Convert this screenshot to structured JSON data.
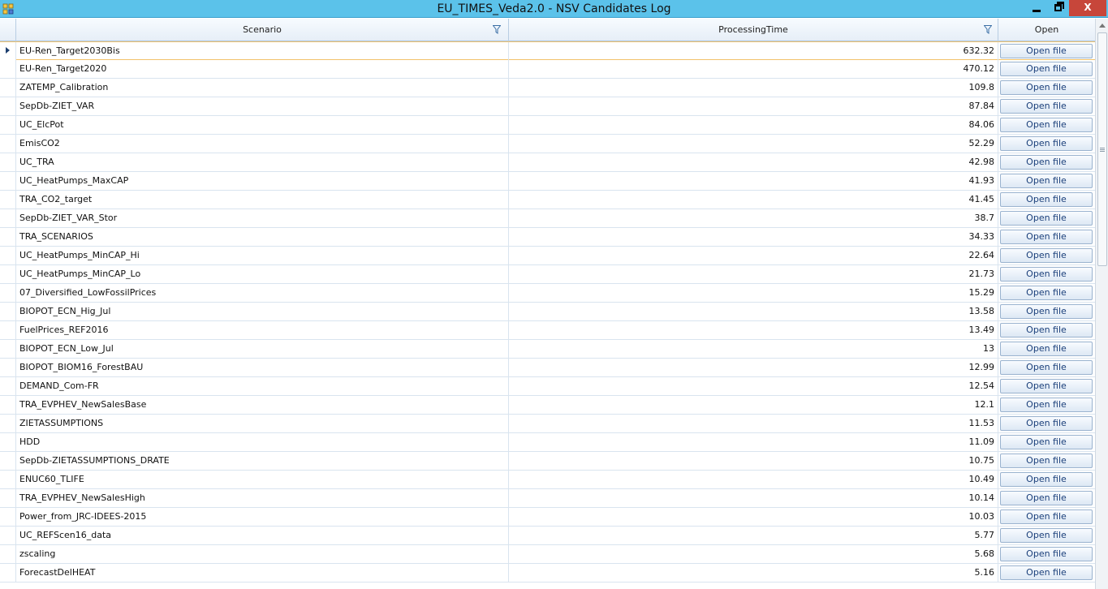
{
  "window": {
    "title": "EU_TIMES_Veda2.0 - NSV Candidates Log",
    "close_label": "X"
  },
  "columns": {
    "scenario": "Scenario",
    "processing_time": "ProcessingTime",
    "open": "Open"
  },
  "current_row_index": 0,
  "open_label": "Open file",
  "rows": [
    {
      "scenario": "EU-Ren_Target2030Bis",
      "time": "632.32"
    },
    {
      "scenario": "EU-Ren_Target2020",
      "time": "470.12"
    },
    {
      "scenario": "ZATEMP_Calibration",
      "time": "109.8"
    },
    {
      "scenario": "SepDb-ZIET_VAR",
      "time": "87.84"
    },
    {
      "scenario": "UC_ElcPot",
      "time": "84.06"
    },
    {
      "scenario": "EmisCO2",
      "time": "52.29"
    },
    {
      "scenario": "UC_TRA",
      "time": "42.98"
    },
    {
      "scenario": "UC_HeatPumps_MaxCAP",
      "time": "41.93"
    },
    {
      "scenario": "TRA_CO2_target",
      "time": "41.45"
    },
    {
      "scenario": "SepDb-ZIET_VAR_Stor",
      "time": "38.7"
    },
    {
      "scenario": "TRA_SCENARIOS",
      "time": "34.33"
    },
    {
      "scenario": "UC_HeatPumps_MinCAP_Hi",
      "time": "22.64"
    },
    {
      "scenario": "UC_HeatPumps_MinCAP_Lo",
      "time": "21.73"
    },
    {
      "scenario": "07_Diversified_LowFossilPrices",
      "time": "15.29"
    },
    {
      "scenario": "BIOPOT_ECN_Hig_Jul",
      "time": "13.58"
    },
    {
      "scenario": "FuelPrices_REF2016",
      "time": "13.49"
    },
    {
      "scenario": "BIOPOT_ECN_Low_Jul",
      "time": "13"
    },
    {
      "scenario": "BIOPOT_BIOM16_ForestBAU",
      "time": "12.99"
    },
    {
      "scenario": "DEMAND_Com-FR",
      "time": "12.54"
    },
    {
      "scenario": "TRA_EVPHEV_NewSalesBase",
      "time": "12.1"
    },
    {
      "scenario": "ZIETASSUMPTIONS",
      "time": "11.53"
    },
    {
      "scenario": "HDD",
      "time": "11.09"
    },
    {
      "scenario": "SepDb-ZIETASSUMPTIONS_DRATE",
      "time": "10.75"
    },
    {
      "scenario": "ENUC60_TLIFE",
      "time": "10.49"
    },
    {
      "scenario": "TRA_EVPHEV_NewSalesHigh",
      "time": "10.14"
    },
    {
      "scenario": "Power_from_JRC-IDEES-2015",
      "time": "10.03"
    },
    {
      "scenario": "UC_REFScen16_data",
      "time": "5.77"
    },
    {
      "scenario": "zscaling",
      "time": "5.68"
    },
    {
      "scenario": "ForecastDelHEAT",
      "time": "5.16"
    }
  ]
}
